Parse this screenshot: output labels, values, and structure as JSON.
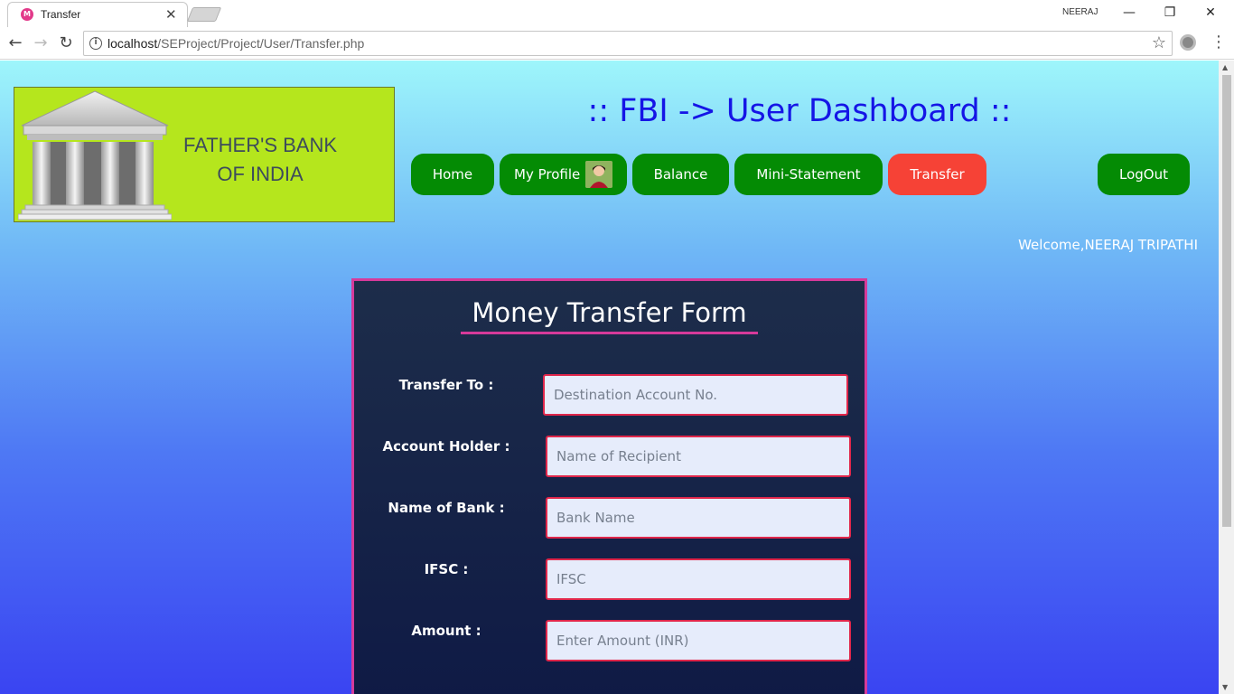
{
  "browser": {
    "tab_title": "Transfer",
    "favicon_text": "M",
    "user_badge": "NEERAJ",
    "url_host": "localhost",
    "url_path": "/SEProject/Project/User/Transfer.php"
  },
  "header": {
    "bank_name_line1": "FATHER'S BANK",
    "bank_name_line2": "OF INDIA",
    "dashboard_title": ":: FBI -> User Dashboard ::"
  },
  "nav": {
    "home": "Home",
    "my_profile": "My Profile",
    "balance": "Balance",
    "mini_statement": "Mini-Statement",
    "transfer": "Transfer",
    "logout": "LogOut",
    "active": "Transfer",
    "active_color": "#f64236",
    "button_color": "#048b04"
  },
  "welcome_text": "Welcome,NEERAJ TRIPATHI",
  "form": {
    "title": "Money Transfer Form",
    "fields": [
      {
        "label": "Transfer To :",
        "placeholder": "Destination Account No."
      },
      {
        "label": "Account Holder :",
        "placeholder": "Name of Recipient"
      },
      {
        "label": "Name of Bank :",
        "placeholder": "Bank Name"
      },
      {
        "label": "IFSC :",
        "placeholder": "IFSC"
      },
      {
        "label": "Amount :",
        "placeholder": "Enter Amount (INR)"
      }
    ],
    "accent_color": "#d63a9a"
  },
  "icons": {
    "back": "back-arrow-icon",
    "forward": "forward-arrow-icon",
    "reload": "reload-icon",
    "info": "info-icon",
    "star": "bookmark-star-icon",
    "menu": "more-vertical-icon"
  }
}
